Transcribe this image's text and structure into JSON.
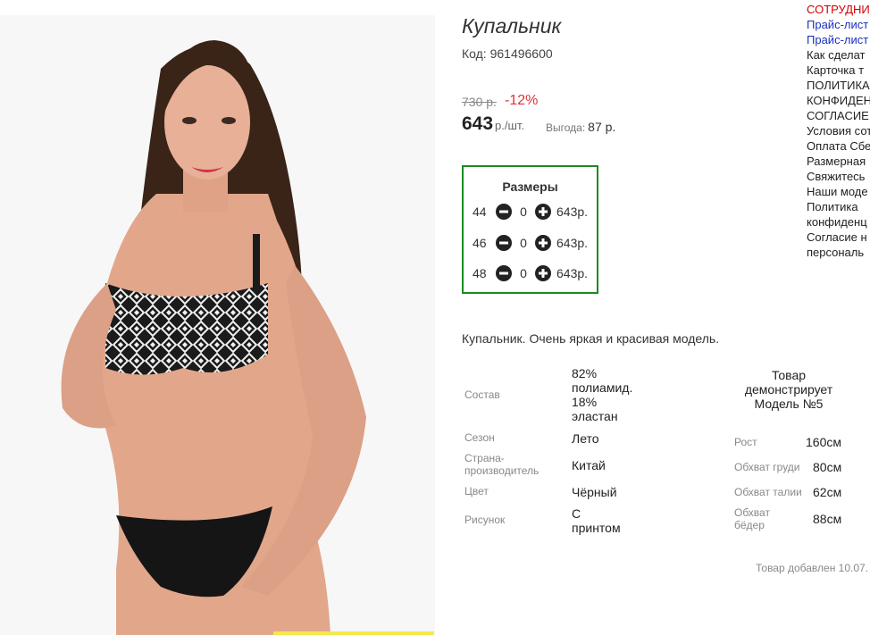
{
  "product": {
    "title": "Купальник",
    "code": "Код: 961496600",
    "old_price": "730 р.",
    "discount": "-12%",
    "price": "643",
    "price_unit": "р./шт.",
    "saving_label": "Выгода:",
    "saving_value": "87 р.",
    "description": "Купальник. Очень яркая и красивая модель."
  },
  "sizes": {
    "title": "Размеры",
    "rows": [
      {
        "size": "44",
        "qty": "0",
        "price": "643р."
      },
      {
        "size": "46",
        "qty": "0",
        "price": "643р."
      },
      {
        "size": "48",
        "qty": "0",
        "price": "643р."
      }
    ]
  },
  "specs": [
    {
      "label": "Состав",
      "value": "82% полиамид. 18% эластан"
    },
    {
      "label": "Сезон",
      "value": "Лето"
    },
    {
      "label": "Страна-производитель",
      "value": "Китай"
    },
    {
      "label": "Цвет",
      "value": "Чёрный"
    },
    {
      "label": "Рисунок",
      "value": "С принтом"
    }
  ],
  "model": {
    "heading": "Товар демонстрирует Модель №5",
    "params": [
      {
        "label": "Рост",
        "value": "160см"
      },
      {
        "label": "Обхват груди",
        "value": "80см"
      },
      {
        "label": "Обхват талии",
        "value": "62см"
      },
      {
        "label": "Обхват бёдер",
        "value": "88см"
      }
    ]
  },
  "added": "Товар добавлен 10.07.",
  "side_menu": [
    {
      "label": "СОТРУДНИЧ",
      "color": "#d40000"
    },
    {
      "label": "Прайс-лист",
      "color": "#1a2fc0"
    },
    {
      "label": "Прайс-лист",
      "color": "#1a2fc0"
    },
    {
      "label": "Как сделат",
      "color": "#222222"
    },
    {
      "label": "Карточка т",
      "color": "#222222"
    },
    {
      "label": "ПОЛИТИКА",
      "color": "#222222"
    },
    {
      "label": "КОНФИДЕН",
      "color": "#222222"
    },
    {
      "label": "СОГЛАСИЕ",
      "color": "#222222"
    },
    {
      "label": "Условия сот",
      "color": "#222222"
    },
    {
      "label": "Оплата Сбе",
      "color": "#222222"
    },
    {
      "label": "Размерная",
      "color": "#222222"
    },
    {
      "label": "Свяжитесь",
      "color": "#222222"
    },
    {
      "label": "Наши моде",
      "color": "#222222"
    },
    {
      "label": "Политика",
      "color": "#222222"
    },
    {
      "label": "конфиденц",
      "color": "#222222"
    },
    {
      "label": "Согласие н",
      "color": "#222222"
    },
    {
      "label": "персональ",
      "color": "#222222"
    }
  ],
  "colors": {
    "accent_green": "#1b8a23",
    "discount_red": "#e0303a",
    "link_blue": "#1a2fc0",
    "link_red": "#d40000"
  }
}
